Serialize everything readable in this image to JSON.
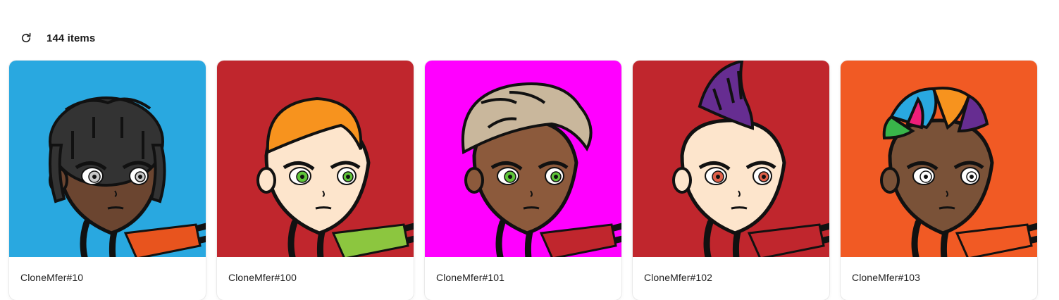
{
  "toolbar": {
    "refresh_icon": "refresh-icon",
    "item_count": "144 items"
  },
  "items": [
    {
      "name": "CloneMfer#10",
      "bg": "#29a8e0",
      "skin": "#6b4530",
      "hair": "#333333",
      "hair_style": "dreads",
      "eyes": "#c9c9c9",
      "shirt": "#e8541e"
    },
    {
      "name": "CloneMfer#100",
      "bg": "#c0262d",
      "skin": "#fde5cc",
      "hair": "#f7931e",
      "hair_style": "short",
      "eyes": "#5fc63a",
      "shirt": "#8cc63f"
    },
    {
      "name": "CloneMfer#101",
      "bg": "#ff00ff",
      "skin": "#8c5a3c",
      "hair": "#c9b79c",
      "hair_style": "swoop",
      "eyes": "#5fc63a",
      "shirt": "#c0262d"
    },
    {
      "name": "CloneMfer#102",
      "bg": "#c0262d",
      "skin": "#fde5cc",
      "hair": "#662d91",
      "hair_style": "mohawk",
      "eyes": "#e0604a",
      "shirt": "#c0262d"
    },
    {
      "name": "CloneMfer#103",
      "bg": "#f15a24",
      "skin": "#7a5238",
      "hair": "#29a8e0",
      "hair_style": "rainbow",
      "eyes": "#ffffff",
      "shirt": "#f15a24"
    }
  ]
}
